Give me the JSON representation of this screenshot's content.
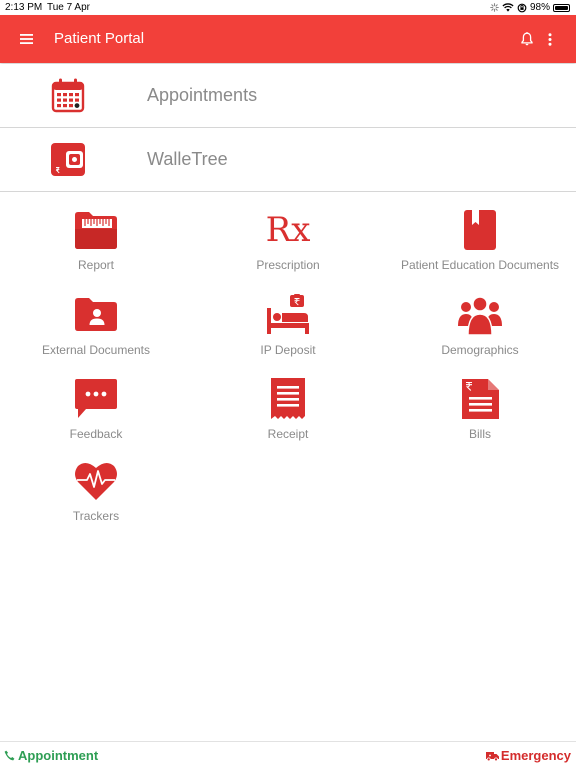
{
  "status_bar": {
    "time": "2:13 PM",
    "date": "Tue 7 Apr",
    "battery": "98%",
    "battery_level": 0.98
  },
  "app_bar": {
    "title": "Patient Portal"
  },
  "primary_rows": [
    {
      "label": "Appointments",
      "icon": "calendar-icon"
    },
    {
      "label": "WalleTree",
      "icon": "wallet-icon"
    }
  ],
  "tiles": [
    {
      "label": "Report",
      "icon": "folder-report-icon"
    },
    {
      "label": "Prescription",
      "icon": "rx-icon",
      "glyph": "Rx"
    },
    {
      "label": "Patient Education Documents",
      "icon": "book-icon"
    },
    {
      "label": "External Documents",
      "icon": "folder-user-icon"
    },
    {
      "label": "IP Deposit",
      "icon": "hospital-bed-icon"
    },
    {
      "label": "Demographics",
      "icon": "people-group-icon"
    },
    {
      "label": "Feedback",
      "icon": "chat-bubble-icon"
    },
    {
      "label": "Receipt",
      "icon": "receipt-icon"
    },
    {
      "label": "Bills",
      "icon": "bill-document-icon"
    },
    {
      "label": "Trackers",
      "icon": "heart-pulse-icon"
    }
  ],
  "bottom_bar": {
    "appointment_label": "Appointment",
    "emergency_label": "Emergency"
  },
  "colors": {
    "primary": "#f2403a",
    "icon_red": "#d9302f",
    "label_grey": "#8a8a8a",
    "appointment_green": "#2e9e54",
    "emergency_red": "#d42c2c"
  }
}
